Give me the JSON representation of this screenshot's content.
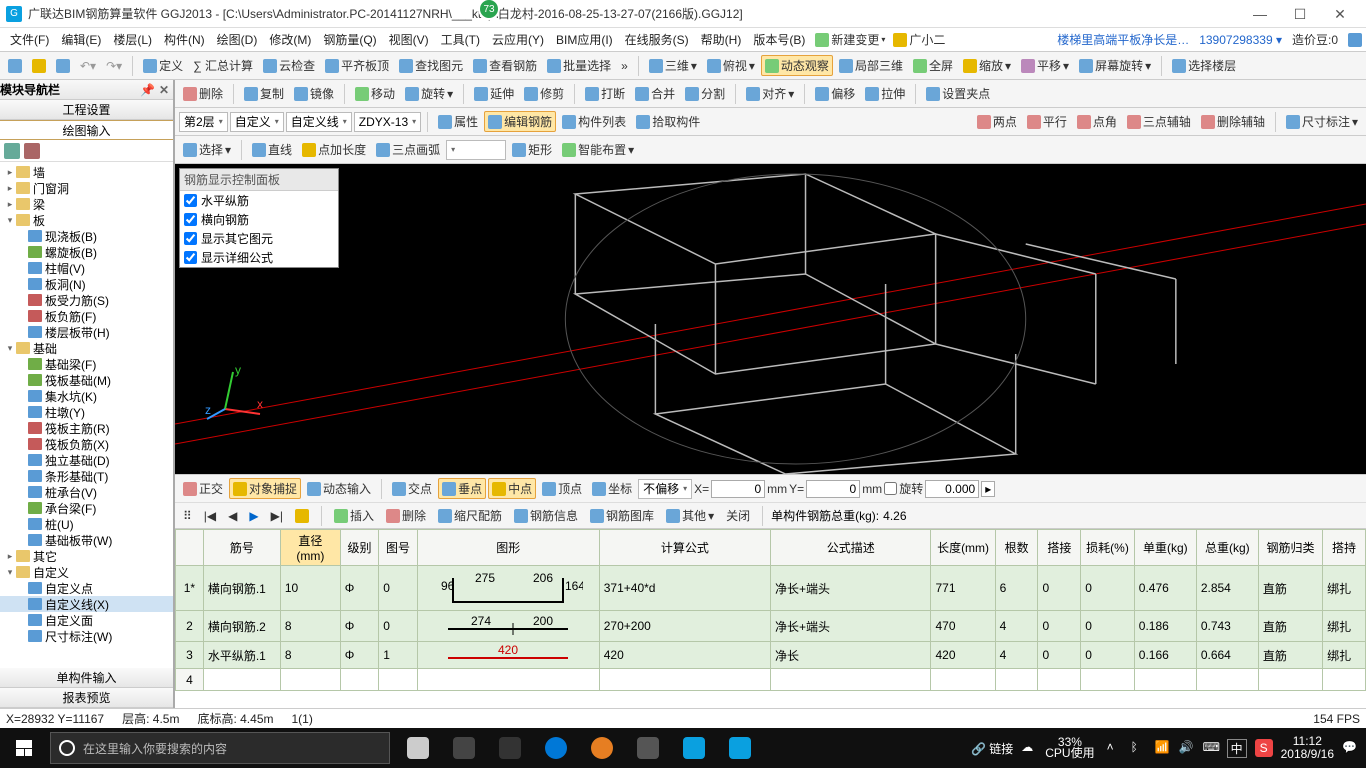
{
  "title": "广联达BIM钢筋算量软件 GGJ2013 - [C:\\Users\\Administrator.PC-20141127NRH\\___ktop\\白龙村-2016-08-25-13-27-07(2166版).GGJ12]",
  "titleBadge": "73",
  "menus": [
    "文件(F)",
    "编辑(E)",
    "楼层(L)",
    "构件(N)",
    "绘图(D)",
    "修改(M)",
    "钢筋量(Q)",
    "视图(V)",
    "工具(T)",
    "云应用(Y)",
    "BIM应用(I)",
    "在线服务(S)",
    "帮助(H)",
    "版本号(B)"
  ],
  "menuRight": {
    "newChange": "新建变更",
    "user": "广小二",
    "marquee": "楼梯里高端平板净长是…",
    "acct": "13907298339",
    "dou": "造价豆:0"
  },
  "tb1": {
    "define": "定义",
    "sumcalc": "∑ 汇总计算",
    "cloud": "云检查",
    "flatroof": "平齐板顶",
    "findgy": "查找图元",
    "viewrebar": "查看钢筋",
    "batchsel": "批量选择",
    "threeD": "三维",
    "aerial": "俯视",
    "dynview": "动态观察",
    "local3d": "局部三维",
    "fullscr": "全屏",
    "zoom": "缩放",
    "pan": "平移",
    "scrrot": "屏幕旋转",
    "selfloor": "选择楼层"
  },
  "tb2": {
    "del": "删除",
    "copy": "复制",
    "mirror": "镜像",
    "move": "移动",
    "rotate": "旋转",
    "extend": "延伸",
    "trim": "修剪",
    "break": "打断",
    "merge": "合并",
    "split": "分割",
    "align": "对齐",
    "offset": "偏移",
    "stretch": "拉伸",
    "setpt": "设置夹点"
  },
  "tb3": {
    "floorSel": "第2层",
    "custom": "自定义",
    "customLine": "自定义线",
    "code": "ZDYX-13",
    "attr": "属性",
    "editrebar": "编辑钢筋",
    "complist": "构件列表",
    "pickcomp": "拾取构件",
    "twopt": "两点",
    "parallel": "平行",
    "ptang": "点角",
    "threept": "三点辅轴",
    "delaux": "删除辅轴",
    "dim": "尺寸标注"
  },
  "tb4": {
    "select": "选择",
    "line": "直线",
    "ptlen": "点加长度",
    "arc3": "三点画弧",
    "rect": "矩形",
    "smart": "智能布置"
  },
  "leftHeader": "模块导航栏",
  "leftTabs": {
    "proj": "工程设置",
    "drawin": "绘图输入"
  },
  "tree": [
    {
      "t": "墙",
      "d": 0,
      "exp": "▸",
      "ic": ""
    },
    {
      "t": "门窗洞",
      "d": 0,
      "exp": "▸",
      "ic": ""
    },
    {
      "t": "梁",
      "d": 0,
      "exp": "▸",
      "ic": ""
    },
    {
      "t": "板",
      "d": 0,
      "exp": "▾",
      "ic": ""
    },
    {
      "t": "现浇板(B)",
      "d": 1,
      "ic": "b"
    },
    {
      "t": "螺旋板(B)",
      "d": 1,
      "ic": "g"
    },
    {
      "t": "柱帽(V)",
      "d": 1,
      "ic": "b"
    },
    {
      "t": "板洞(N)",
      "d": 1,
      "ic": "b"
    },
    {
      "t": "板受力筋(S)",
      "d": 1,
      "ic": "r"
    },
    {
      "t": "板负筋(F)",
      "d": 1,
      "ic": "r"
    },
    {
      "t": "楼层板带(H)",
      "d": 1,
      "ic": "b"
    },
    {
      "t": "基础",
      "d": 0,
      "exp": "▾",
      "ic": ""
    },
    {
      "t": "基础梁(F)",
      "d": 1,
      "ic": "g"
    },
    {
      "t": "筏板基础(M)",
      "d": 1,
      "ic": "g"
    },
    {
      "t": "集水坑(K)",
      "d": 1,
      "ic": "b"
    },
    {
      "t": "柱墩(Y)",
      "d": 1,
      "ic": "b"
    },
    {
      "t": "筏板主筋(R)",
      "d": 1,
      "ic": "r"
    },
    {
      "t": "筏板负筋(X)",
      "d": 1,
      "ic": "r"
    },
    {
      "t": "独立基础(D)",
      "d": 1,
      "ic": "b"
    },
    {
      "t": "条形基础(T)",
      "d": 1,
      "ic": "b"
    },
    {
      "t": "桩承台(V)",
      "d": 1,
      "ic": "b"
    },
    {
      "t": "承台梁(F)",
      "d": 1,
      "ic": "g"
    },
    {
      "t": "桩(U)",
      "d": 1,
      "ic": "b"
    },
    {
      "t": "基础板带(W)",
      "d": 1,
      "ic": "b"
    },
    {
      "t": "其它",
      "d": 0,
      "exp": "▸",
      "ic": ""
    },
    {
      "t": "自定义",
      "d": 0,
      "exp": "▾",
      "ic": ""
    },
    {
      "t": "自定义点",
      "d": 1,
      "ic": "b"
    },
    {
      "t": "自定义线(X)",
      "d": 1,
      "ic": "b",
      "sel": true
    },
    {
      "t": "自定义面",
      "d": 1,
      "ic": "b"
    },
    {
      "t": "尺寸标注(W)",
      "d": 1,
      "ic": "b"
    }
  ],
  "leftBottom": {
    "single": "单构件输入",
    "report": "报表预览"
  },
  "overlay": {
    "title": "钢筋显示控制面板",
    "items": [
      "水平纵筋",
      "横向钢筋",
      "显示其它图元",
      "显示详细公式"
    ]
  },
  "snap": {
    "ortho": "正交",
    "osnap": "对象捕捉",
    "dyn": "动态输入",
    "inter": "交点",
    "perp": "垂点",
    "mid": "中点",
    "vertex": "顶点",
    "coord": "坐标",
    "noofs": "不偏移",
    "xlbl": "X=",
    "xval": "0",
    "mm": "mm",
    "ylbl": "Y=",
    "yval": "0",
    "rot": "旋转",
    "rotval": "0.000"
  },
  "rbtools": {
    "nav": [
      "|◀",
      "◀",
      "▶",
      "▶|"
    ],
    "insert": "插入",
    "del": "删除",
    "scaledist": "缩尺配筋",
    "rebarinfo": "钢筋信息",
    "rebarlib": "钢筋图库",
    "other": "其他",
    "close": "关闭",
    "totalLabel": "单构件钢筋总重(kg):",
    "totalVal": "4.26"
  },
  "tableHeaders": [
    "",
    "筋号",
    "直径(mm)",
    "级别",
    "图号",
    "图形",
    "计算公式",
    "公式描述",
    "长度(mm)",
    "根数",
    "搭接",
    "损耗(%)",
    "单重(kg)",
    "总重(kg)",
    "钢筋归类",
    "搭持"
  ],
  "rows": [
    {
      "n": "1*",
      "id": "横向钢筋.1",
      "dia": "10",
      "grade": "Φ",
      "fig": "0",
      "shape": {
        "type": "u",
        "a": "96",
        "b": "275",
        "c": "206",
        "d": "164"
      },
      "calc": "371+40*d",
      "desc": "净长+端头",
      "len": "771",
      "cnt": "6",
      "lap": "0",
      "loss": "0",
      "uw": "0.476",
      "tw": "2.854",
      "cls": "直筋",
      "hold": "绑扎"
    },
    {
      "n": "2",
      "id": "横向钢筋.2",
      "dia": "8",
      "grade": "Φ",
      "fig": "0",
      "shape": {
        "type": "line2",
        "a": "274",
        "b": "200"
      },
      "calc": "270+200",
      "desc": "净长+端头",
      "len": "470",
      "cnt": "4",
      "lap": "0",
      "loss": "0",
      "uw": "0.186",
      "tw": "0.743",
      "cls": "直筋",
      "hold": "绑扎"
    },
    {
      "n": "3",
      "id": "水平纵筋.1",
      "dia": "8",
      "grade": "Φ",
      "fig": "1",
      "shape": {
        "type": "line1",
        "a": "420",
        "red": true
      },
      "calc": "420",
      "desc": "净长",
      "len": "420",
      "cnt": "4",
      "lap": "0",
      "loss": "0",
      "uw": "0.166",
      "tw": "0.664",
      "cls": "直筋",
      "hold": "绑扎"
    }
  ],
  "status": {
    "xy": "X=28932 Y=11167",
    "floor": "层高: 4.5m",
    "bot": "底标高: 4.45m",
    "sel": "1(1)",
    "fps": "154 FPS"
  },
  "taskbar": {
    "searchPH": "在这里输入你要搜索的内容",
    "link": "链接",
    "cpu": "33%",
    "cpulabel": "CPU使用",
    "time": "11:12",
    "date": "2018/9/16",
    "ime": "中"
  }
}
